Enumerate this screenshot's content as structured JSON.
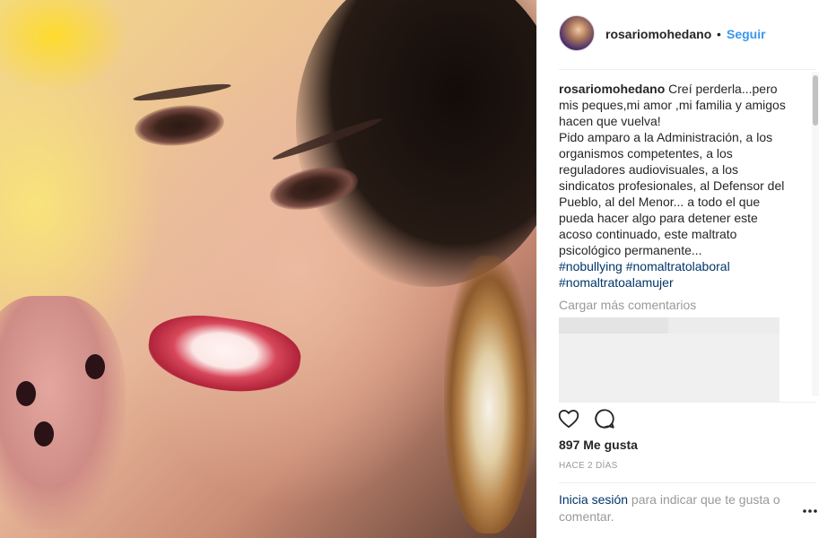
{
  "post": {
    "username": "rosariomohedano",
    "separator": "•",
    "follow_label": "Seguir"
  },
  "caption": {
    "username": "rosariomohedano",
    "lines": [
      " Creí perderla...pero",
      "mis peques,mi amor ,mi familia y amigos",
      "hacen que vuelva!",
      "Pido amparo a la Administración, a los",
      "organismos competentes, a los",
      "reguladores audiovisuales, a los",
      "sindicatos profesionales, al Defensor del",
      "Pueblo, al del Menor... a todo el que",
      "pueda hacer algo para detener este",
      "acoso continuado, este maltrato",
      "psicológico permanente..."
    ],
    "hashtags": [
      "#nobullying #nomaltratolaboral",
      "#nomaltratoalamujer"
    ]
  },
  "comments": {
    "load_more_label": "Cargar más comentarios"
  },
  "actions": {
    "like_icon": "heart-icon",
    "comment_icon": "comment-bubble-icon"
  },
  "stats": {
    "likes_label": "897 Me gusta",
    "time_label": "HACE 2 DÍAS"
  },
  "footer": {
    "login_link": "Inicia sesión",
    "login_text": " para indicar que te gusta o comentar.",
    "more_icon": "ellipsis-icon"
  },
  "colors": {
    "link_blue": "#3897f0",
    "hashtag_navy": "#003569",
    "muted": "#999999",
    "text": "#262626"
  }
}
